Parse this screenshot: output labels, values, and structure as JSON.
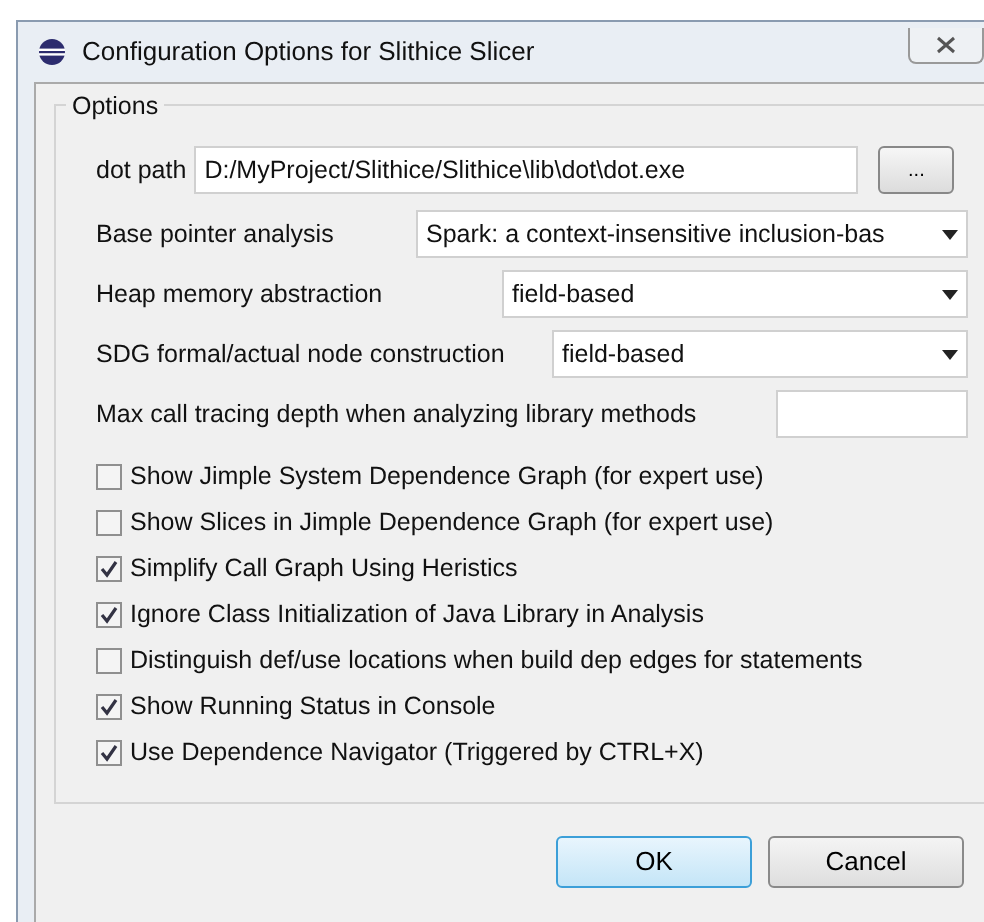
{
  "window": {
    "title": "Configuration Options for Slithice Slicer"
  },
  "group": {
    "title": "Options"
  },
  "dot_path": {
    "label": "dot path",
    "value": "D:/MyProject/Slithice/Slithice\\lib\\dot\\dot.exe",
    "browse": "..."
  },
  "dropdowns": [
    {
      "label": "Base pointer analysis",
      "value": "Spark: a context-insensitive inclusion-bas"
    },
    {
      "label": "Heap memory abstraction",
      "value": "field-based"
    },
    {
      "label": "SDG formal/actual node construction",
      "value": "field-based"
    }
  ],
  "depth": {
    "label": "Max call tracing depth when analyzing library methods"
  },
  "options": [
    {
      "label": "Show Jimple System Dependence Graph (for expert use)",
      "checked": false
    },
    {
      "label": "Show Slices in Jimple Dependence Graph (for expert use)",
      "checked": false
    },
    {
      "label": "Simplify Call Graph Using Heristics",
      "checked": true
    },
    {
      "label": "Ignore Class Initialization of Java Library in Analysis",
      "checked": true
    },
    {
      "label": "Distinguish def/use locations when build dep edges for statements",
      "checked": false
    },
    {
      "label": "Show Running Status in Console",
      "checked": true
    },
    {
      "label": "Use Dependence Navigator (Triggered by CTRL+X)",
      "checked": true
    }
  ],
  "buttons": [
    {
      "label": "OK",
      "kind": "default"
    },
    {
      "label": "Cancel",
      "kind": "normal"
    }
  ]
}
